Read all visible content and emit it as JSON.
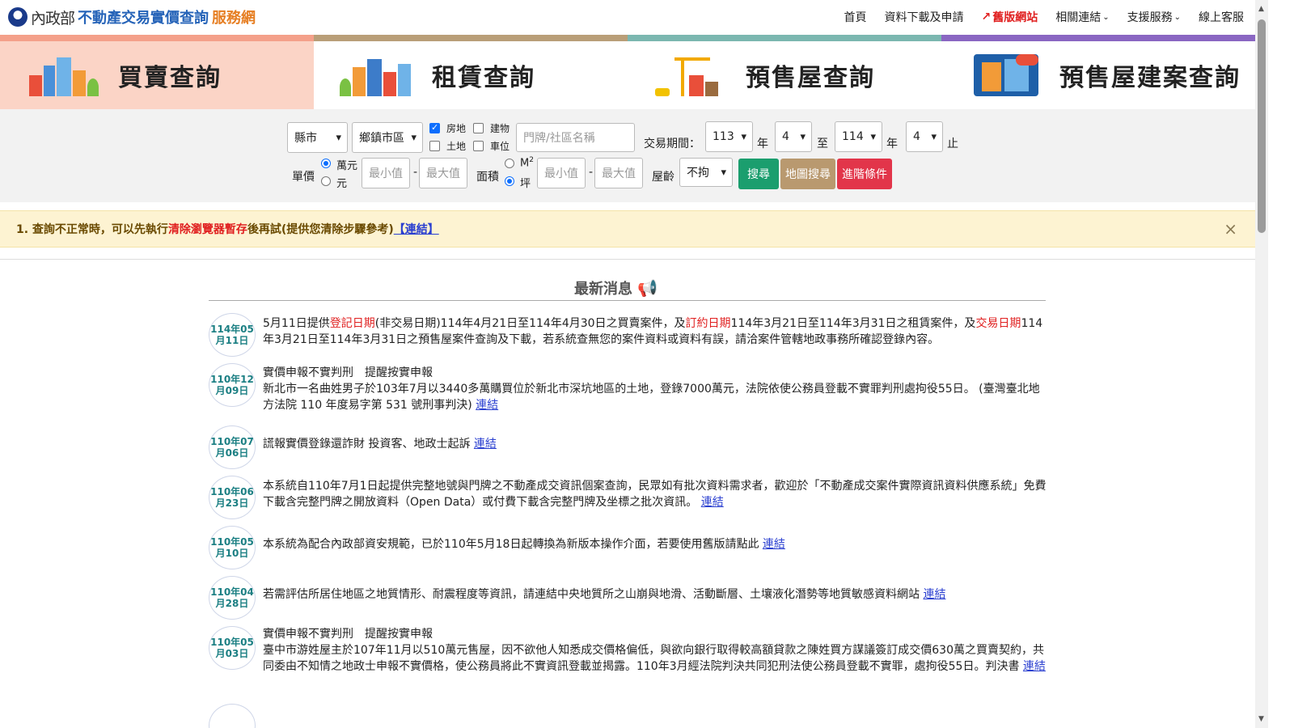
{
  "header": {
    "brand_ministry": "內政部",
    "brand_main": "不動產交易實價查詢",
    "brand_suffix": "服務網",
    "nav": {
      "home": "首頁",
      "download": "資料下載及申請",
      "old_site": "舊版網站",
      "links": "相關連結",
      "support": "支援服務",
      "online_service": "線上客服"
    }
  },
  "tabs": [
    {
      "label": "買賣查詢",
      "color": "#f4a08a"
    },
    {
      "label": "租賃查詢",
      "color": "#b99e78"
    },
    {
      "label": "預售屋查詢",
      "color": "#7bb7b0"
    },
    {
      "label": "預售屋建案查詢",
      "color": "#8a66c2"
    }
  ],
  "filters": {
    "county": "縣市",
    "township": "鄉鎮市區",
    "land_building": "房地",
    "building": "建物",
    "land": "土地",
    "parking": "車位",
    "address_placeholder": "門牌/社區名稱",
    "period_label": "交易期間：",
    "year_from": "113",
    "year_unit": "年",
    "month_from": "4",
    "to_label": "至",
    "year_to": "114",
    "month_to": "4",
    "end_label": "止",
    "unit_price_label": "單價",
    "wan_yuan": "萬元",
    "yuan": "元",
    "min_placeholder": "最小值",
    "max_placeholder": "最大值",
    "dash": "-",
    "area_label": "面積",
    "m2": "M",
    "m2_sup": "2",
    "ping": "坪",
    "age_label": "屋齡",
    "age_value": "不拘",
    "search_btn": "搜尋",
    "map_search_btn": "地圖搜尋",
    "advanced_btn": "進階條件"
  },
  "alert": {
    "prefix": "1. 查詢不正常時，可以先執行",
    "highlight": "清除瀏覽器暫存",
    "suffix": "後再試(提供您清除步驟參考)",
    "link": "【連結】",
    "close": "×"
  },
  "news": {
    "title": "最新消息",
    "items": [
      {
        "y": "114年05",
        "d": "月11日"
      },
      {
        "y": "110年12",
        "d": "月09日",
        "head": "實價申報不實判刑　提醒按實申報",
        "body": "新北市一名曲姓男子於103年7月以3440多萬購買位於新北市深坑地區的土地，登錄7000萬元，法院依使公務員登載不實罪判刑處拘役55日。 (臺灣臺北地方法院 110 年度易字第 531 號刑事判決)",
        "link": "連結"
      },
      {
        "y": "110年07",
        "d": "月06日",
        "body": "謊報實價登錄還詐財 投資客、地政士起訴",
        "link": "連結"
      },
      {
        "y": "110年06",
        "d": "月23日",
        "body": "本系統自110年7月1日起提供完整地號與門牌之不動產成交資訊個案查詢，民眾如有批次資料需求者，歡迎於「不動產成交案件實際資訊資料供應系統」免費下載含完整門牌之開放資料（Open Data）或付費下載含完整門牌及坐標之批次資訊。",
        "link": "連結"
      },
      {
        "y": "110年05",
        "d": "月10日",
        "body": "本系統為配合內政部資安規範，已於110年5月18日起轉換為新版本操作介面，若要使用舊版請點此",
        "link": "連結"
      },
      {
        "y": "110年04",
        "d": "月28日",
        "body": "若需評估所居住地區之地質情形、耐震程度等資訊，請連結中央地質所之山崩與地滑、活動斷層、土壤液化潛勢等地質敏感資料網站",
        "link": "連結"
      },
      {
        "y": "110年05",
        "d": "月03日",
        "head": "實價申報不實判刑　提醒按實申報",
        "body": "臺中市游姓屋主於107年11月以510萬元售屋，因不欲他人知悉成交價格偏低，與欲向銀行取得較高額貸款之陳姓買方謀議簽訂成交價630萬之買賣契約，共同委由不知情之地政士申報不實價格，使公務員將此不實資訊登載並揭露。110年3月經法院判決共同犯刑法使公務員登載不實罪，處拘役55日。判決書",
        "link": "連結"
      }
    ],
    "first": {
      "t1": "5月11日提供",
      "r1": "登記日期",
      "t2": "(非交易日期)114年4月21日至114年4月30日之買賣案件，及",
      "r2": "訂約日期",
      "t3": "114年3月21日至114年3月31日之租賃案件，及",
      "r3": "交易日期",
      "t4": "114年3月21日至114年3月31日之預售屋案件查詢及下載，若系統查無您的案件資料或資料有誤，請洽案件管轄地政事務所確認登錄內容。"
    }
  }
}
